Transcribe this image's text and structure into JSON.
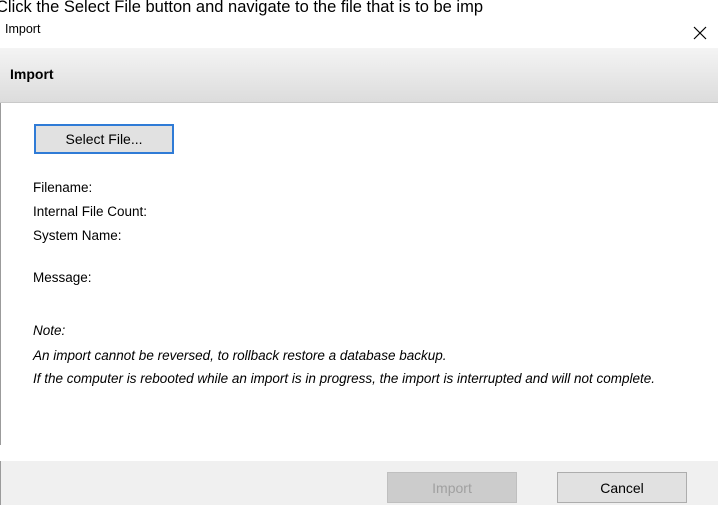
{
  "caption": "Click the Select File button and navigate to the file that is to be imp",
  "window": {
    "title": "Import",
    "close_icon": "close-icon"
  },
  "header": {
    "title": "Import"
  },
  "main": {
    "select_file_label": "Select File...",
    "fields": {
      "filename": "Filename:",
      "internal_file_count": "Internal File Count:",
      "system_name": "System Name:",
      "message": "Message:"
    },
    "note": {
      "heading": "Note:",
      "line1": "An import cannot be reversed, to rollback restore a database backup.",
      "line2": "If the computer is rebooted while an import is in progress, the import is interrupted and will not complete."
    }
  },
  "footer": {
    "import_label": "Import",
    "import_enabled": false,
    "cancel_label": "Cancel"
  },
  "colors": {
    "focus_border": "#2f7bd6",
    "disabled_text": "#a0a0a0"
  }
}
